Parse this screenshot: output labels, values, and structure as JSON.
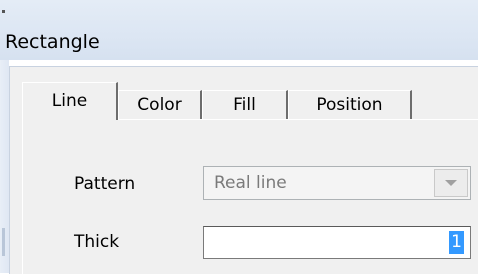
{
  "window": {
    "title": "Rectangle"
  },
  "tabs": [
    {
      "label": "Line",
      "active": true
    },
    {
      "label": "Color",
      "active": false
    },
    {
      "label": "Fill",
      "active": false
    },
    {
      "label": "Position",
      "active": false
    }
  ],
  "form": {
    "pattern": {
      "label": "Pattern",
      "value": "Real line",
      "enabled": false
    },
    "thick": {
      "label": "Thick",
      "value": "1"
    }
  },
  "colors": {
    "selection": "#3399ff",
    "titlebar": "#dce6f3",
    "client": "#f0f0f0"
  }
}
